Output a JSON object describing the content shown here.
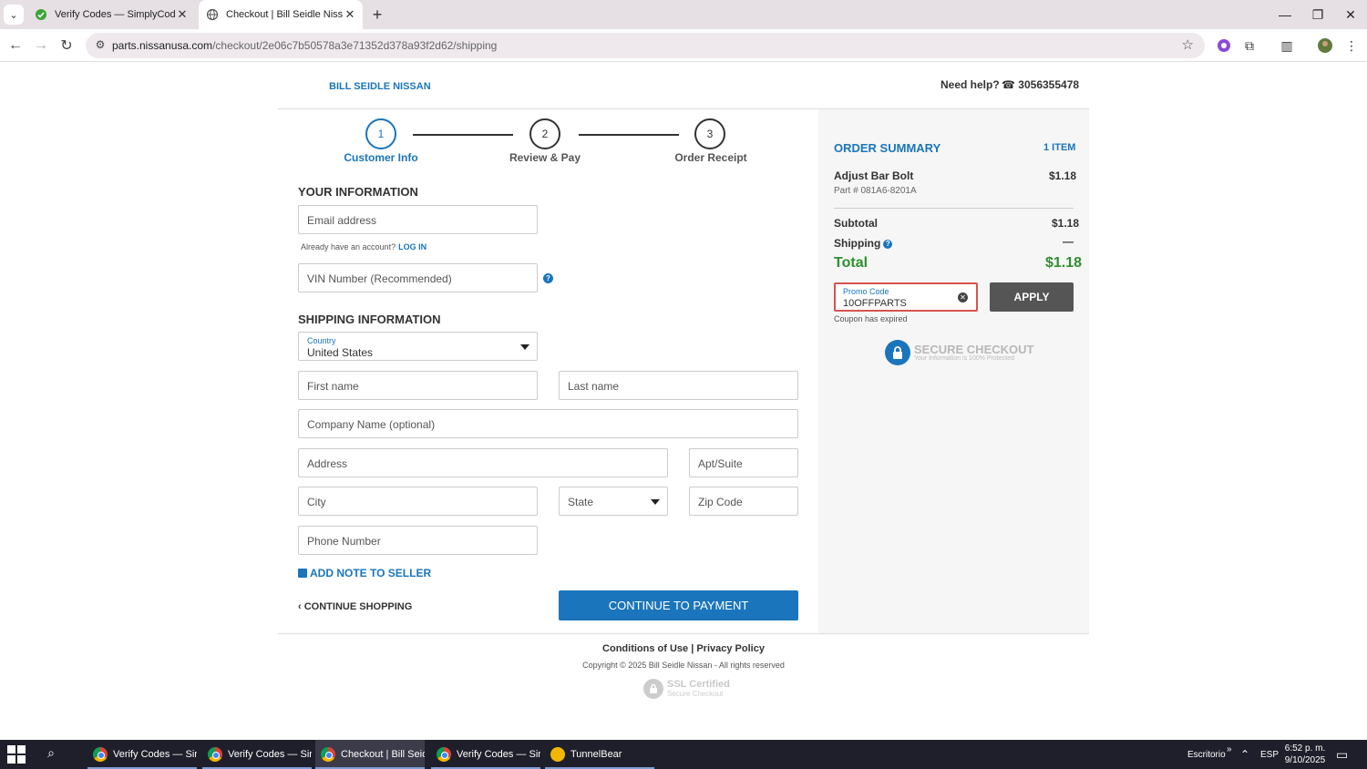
{
  "browser": {
    "tabs": [
      {
        "title": "Verify Codes — SimplyCodes",
        "active": false
      },
      {
        "title": "Checkout | Bill Seidle Nissan",
        "active": true
      }
    ],
    "url_host": "parts.nissanusa.com",
    "url_path": "/checkout/2e06c7b50578a3e71352d378a93f2d62/shipping"
  },
  "header": {
    "brand": "BILL SEIDLE NISSAN",
    "help_label": "Need help?",
    "phone": "3056355478"
  },
  "steps": [
    {
      "num": "1",
      "label": "Customer Info"
    },
    {
      "num": "2",
      "label": "Review & Pay"
    },
    {
      "num": "3",
      "label": "Order Receipt"
    }
  ],
  "form": {
    "your_info_title": "YOUR INFORMATION",
    "email_placeholder": "Email address",
    "account_note": "Already have an account?",
    "login_link": "LOG IN",
    "vin_placeholder": "VIN Number (Recommended)",
    "shipping_title": "SHIPPING INFORMATION",
    "country_label": "Country",
    "country_value": "United States",
    "first_name": "First name",
    "last_name": "Last name",
    "company": "Company Name (optional)",
    "address": "Address",
    "apt": "Apt/Suite",
    "city": "City",
    "state": "State",
    "zip": "Zip Code",
    "phone": "Phone Number",
    "add_note": "ADD NOTE TO SELLER",
    "continue_shopping": "CONTINUE SHOPPING",
    "continue_payment": "CONTINUE TO PAYMENT"
  },
  "summary": {
    "title": "ORDER SUMMARY",
    "count": "1 ITEM",
    "item_name": "Adjust Bar Bolt",
    "item_price": "$1.18",
    "item_part": "Part # 081A6-8201A",
    "subtotal_label": "Subtotal",
    "subtotal_value": "$1.18",
    "shipping_label": "Shipping",
    "shipping_value": "—",
    "total_label": "Total",
    "total_value": "$1.18",
    "promo_label": "Promo Code",
    "promo_value": "10OFFPARTS",
    "apply": "APPLY",
    "promo_error": "Coupon has expired",
    "secure_title": "SECURE CHECKOUT",
    "secure_sub": "Your Information is 100% Protected"
  },
  "footer": {
    "conditions": "Conditions of Use",
    "separator": "|",
    "privacy": "Privacy Policy",
    "copyright": "Copyright © 2025 Bill Seidle Nissan - All rights reserved",
    "ssl_title": "SSL Certified",
    "ssl_sub": "Secure Checkout"
  },
  "taskbar": {
    "items": [
      {
        "label": "Verify Codes — Sim..."
      },
      {
        "label": "Verify Codes — Sim..."
      },
      {
        "label": "Checkout | Bill Seid..."
      },
      {
        "label": "Verify Codes — Sim..."
      },
      {
        "label": "TunnelBear"
      }
    ],
    "desktop": "Escritorio",
    "language": "ESP",
    "time": "6:52 p. m.",
    "date": "9/10/2025"
  },
  "colors": {
    "accent": "#1a75bc",
    "total_green": "#2f8f2f",
    "error_red": "#d9534f",
    "apply_gray": "#555555"
  }
}
